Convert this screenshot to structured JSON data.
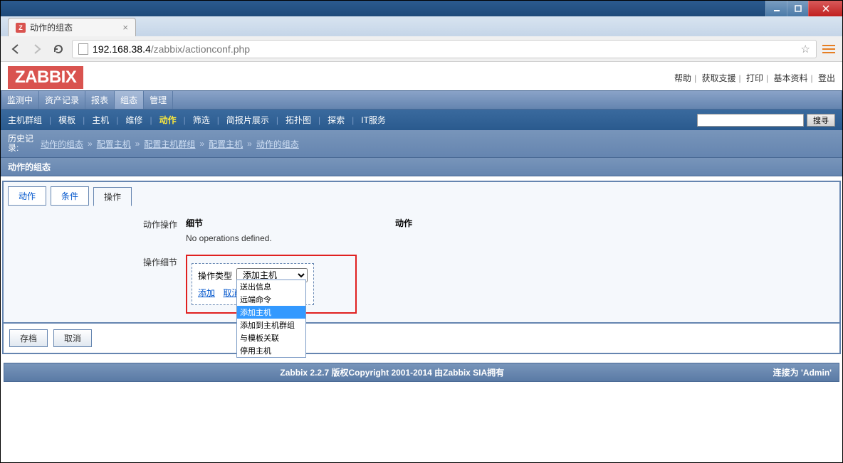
{
  "window": {
    "title": "动作的组态"
  },
  "browser": {
    "tab_title": "动作的组态",
    "url_host": "192.168.38.4",
    "url_path": "/zabbix/actionconf.php"
  },
  "toplinks": {
    "help": "帮助",
    "support": "获取支援",
    "print": "打印",
    "profile": "基本资料",
    "logout": "登出"
  },
  "logo": "ZABBIX",
  "nav1": [
    {
      "label": "监测中",
      "active": false
    },
    {
      "label": "资产记录",
      "active": false
    },
    {
      "label": "报表",
      "active": false
    },
    {
      "label": "组态",
      "active": true
    },
    {
      "label": "管理",
      "active": false
    }
  ],
  "nav2": [
    {
      "label": "主机群组",
      "active": false
    },
    {
      "label": "模板",
      "active": false
    },
    {
      "label": "主机",
      "active": false
    },
    {
      "label": "维修",
      "active": false
    },
    {
      "label": "动作",
      "active": true
    },
    {
      "label": "筛选",
      "active": false
    },
    {
      "label": "简报片展示",
      "active": false
    },
    {
      "label": "拓扑图",
      "active": false
    },
    {
      "label": "探索",
      "active": false
    },
    {
      "label": "IT服务",
      "active": false
    }
  ],
  "search": {
    "placeholder": "",
    "button": "搜寻"
  },
  "breadcrumb": {
    "label": "历史记录:",
    "items": [
      "动作的组态",
      "配置主机",
      "配置主机群组",
      "配置主机",
      "动作的组态"
    ]
  },
  "section_title": "动作的组态",
  "panel_tabs": [
    {
      "label": "动作",
      "active": false
    },
    {
      "label": "条件",
      "active": false
    },
    {
      "label": "操作",
      "active": true
    }
  ],
  "form": {
    "action_ops_label": "动作操作",
    "ops_col1": "细节",
    "ops_col2": "动作",
    "ops_empty": "No operations defined.",
    "detail_label": "操作细节",
    "optype_label": "操作类型",
    "optype_selected": "添加主机",
    "optype_options": [
      "送出信息",
      "远端命令",
      "添加主机",
      "添加到主机群组",
      "与模板关联",
      "停用主机"
    ],
    "add_link": "添加",
    "cancel_link": "取消"
  },
  "actions": {
    "save": "存档",
    "cancel": "取消"
  },
  "footer": {
    "text": "Zabbix 2.2.7 版权Copyright 2001-2014 由Zabbix SIA拥有",
    "status": "连接为 'Admin'"
  }
}
